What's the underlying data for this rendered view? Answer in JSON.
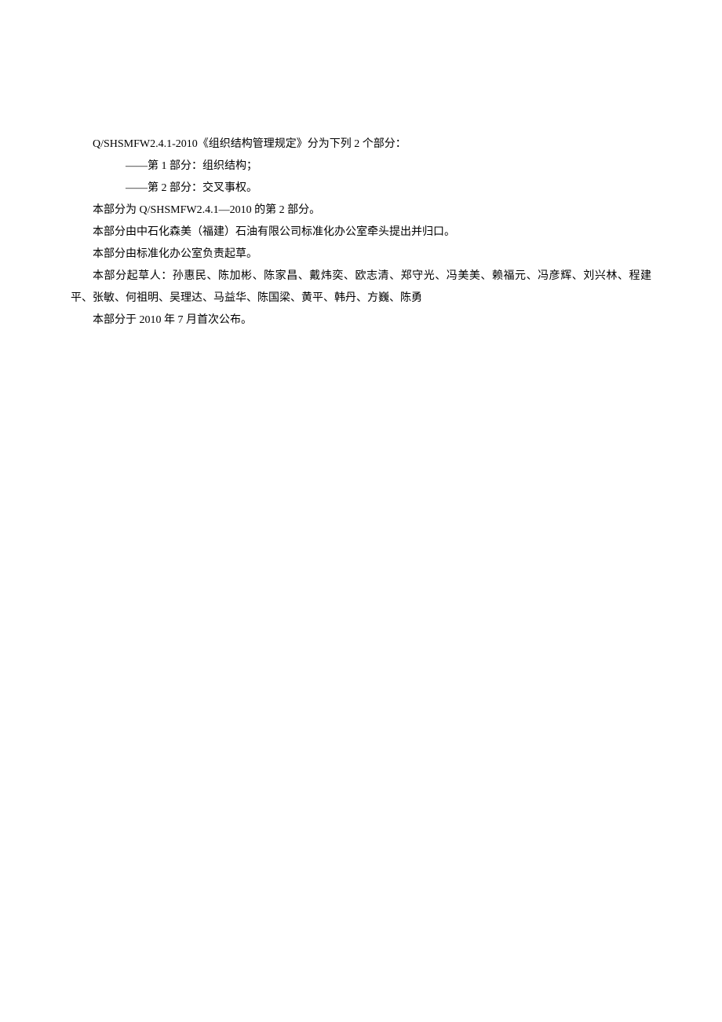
{
  "document": {
    "line1": "Q/SHSMFW2.4.1-2010《组织结构管理规定》分为下列 2 个部分：",
    "line2": "——第 1 部分：组织结构；",
    "line3": "——第 2 部分：交叉事权。",
    "line4": "本部分为 Q/SHSMFW2.4.1—2010 的第 2 部分。",
    "line5": "本部分由中石化森美（福建）石油有限公司标准化办公室牵头提出并归口。",
    "line6": "本部分由标准化办公室负责起草。",
    "line7": "本部分起草人：孙惠民、陈加彬、陈家昌、戴炜奕、欧志清、郑守光、冯美美、赖福元、冯彦辉、刘兴林、程建平、张敏、何祖明、吴理达、马益华、陈国梁、黄平、韩丹、方巍、陈勇",
    "line8": "本部分于 2010 年 7 月首次公布。"
  }
}
